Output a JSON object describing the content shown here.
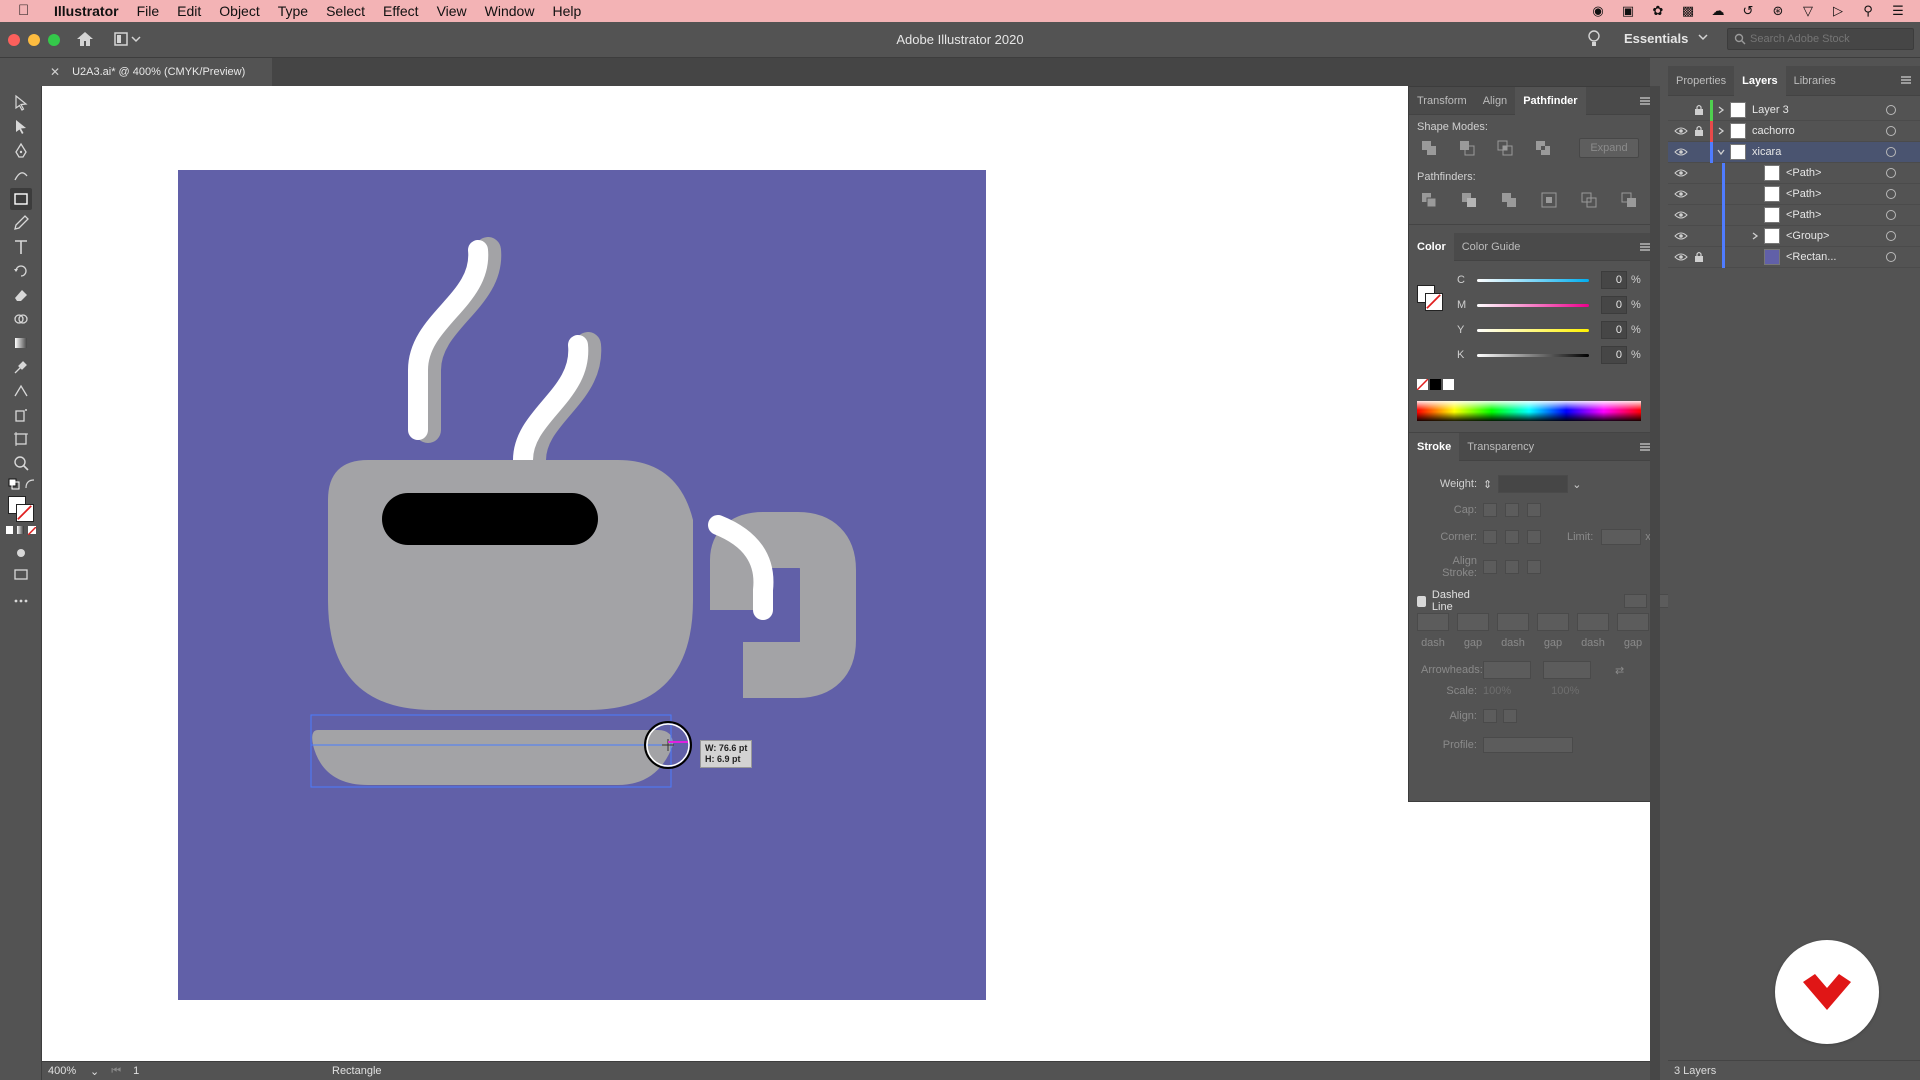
{
  "menubar": {
    "app_name": "Illustrator",
    "items": [
      "File",
      "Edit",
      "Object",
      "Type",
      "Select",
      "Effect",
      "View",
      "Window",
      "Help"
    ]
  },
  "titlebar": {
    "title": "Adobe Illustrator 2020",
    "workspace": "Essentials",
    "stock_search_placeholder": "Search Adobe Stock"
  },
  "document": {
    "tab_label": "U2A3.ai* @ 400% (CMYK/Preview)"
  },
  "pathfinder_panel": {
    "tabs": [
      "Transform",
      "Align",
      "Pathfinder"
    ],
    "active_tab": "Pathfinder",
    "shape_modes_label": "Shape Modes:",
    "expand_label": "Expand",
    "pathfinders_label": "Pathfinders:"
  },
  "color_panel": {
    "tabs": [
      "Color",
      "Color Guide"
    ],
    "active_tab": "Color",
    "channels": [
      {
        "label": "C",
        "value": "0",
        "unit": "%",
        "color": "#00aeef"
      },
      {
        "label": "M",
        "value": "0",
        "unit": "%",
        "color": "#ec008c"
      },
      {
        "label": "Y",
        "value": "0",
        "unit": "%",
        "color": "#fff200"
      },
      {
        "label": "K",
        "value": "0",
        "unit": "%",
        "color": "#000000"
      }
    ]
  },
  "stroke_panel": {
    "tabs": [
      "Stroke",
      "Transparency"
    ],
    "active_tab": "Stroke",
    "weight_label": "Weight:",
    "cap_label": "Cap:",
    "corner_label": "Corner:",
    "limit_label": "Limit:",
    "limit_unit": "x",
    "align_stroke_label": "Align Stroke:",
    "dashed_line_label": "Dashed Line",
    "dash_gap_labels": [
      "dash",
      "gap",
      "dash",
      "gap",
      "dash",
      "gap"
    ],
    "arrowheads_label": "Arrowheads:",
    "scale_label": "Scale:",
    "scale_values": [
      "100%",
      "100%"
    ],
    "align_label": "Align:",
    "profile_label": "Profile:"
  },
  "layers_panel": {
    "tabs": [
      "Properties",
      "Layers",
      "Libraries"
    ],
    "active_tab": "Layers",
    "rows": [
      {
        "name": "Layer 3",
        "visible": false,
        "locked": true,
        "color": "#4fd04f",
        "expanded": false,
        "level": 0,
        "selected": false
      },
      {
        "name": "cachorro",
        "visible": true,
        "locked": true,
        "color": "#e84a4a",
        "expanded": false,
        "level": 0,
        "selected": false
      },
      {
        "name": "xicara",
        "visible": true,
        "locked": false,
        "color": "#4f7cff",
        "expanded": true,
        "level": 0,
        "selected": true
      },
      {
        "name": "<Path>",
        "visible": true,
        "locked": false,
        "color": "#4f7cff",
        "expanded": false,
        "level": 1,
        "selected": false
      },
      {
        "name": "<Path>",
        "visible": true,
        "locked": false,
        "color": "#4f7cff",
        "expanded": false,
        "level": 1,
        "selected": false
      },
      {
        "name": "<Path>",
        "visible": true,
        "locked": false,
        "color": "#4f7cff",
        "expanded": false,
        "level": 1,
        "selected": false
      },
      {
        "name": "<Group>",
        "visible": true,
        "locked": false,
        "color": "#4f7cff",
        "expanded": false,
        "level": 1,
        "selected": false
      },
      {
        "name": "<Rectan...",
        "visible": true,
        "locked": true,
        "color": "#4f7cff",
        "expanded": false,
        "level": 1,
        "selected": false
      }
    ],
    "footer_count": "3 Layers"
  },
  "statusbar": {
    "zoom": "400%",
    "artboard_number": "1",
    "current_tool": "Rectangle"
  },
  "artwork": {
    "background_color": "#6160a8",
    "cup_color": "#a3a3a6",
    "steam_color": "#ffffff",
    "dimension_tooltip": {
      "w": "W: 76.6 pt",
      "h": "H: 6.9 pt"
    }
  }
}
